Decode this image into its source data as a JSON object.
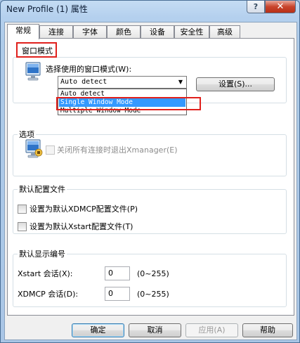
{
  "window": {
    "title": "New Profile (1) 属性",
    "help_glyph": "?",
    "close_glyph": "✕"
  },
  "tabs": [
    "常规",
    "连接",
    "字体",
    "颜色",
    "设备",
    "安全性",
    "高级"
  ],
  "window_mode": {
    "legend": "窗口模式",
    "prompt": "选择使用的窗口模式(W):",
    "selected": "Auto detect",
    "options": [
      "Auto detect",
      "Single Window Mode",
      "Multiple Window Mode"
    ],
    "highlighted_option": "Single Window Mode",
    "settings_button": "设置(S)..."
  },
  "options": {
    "legend": "选项",
    "close_on_exit_label": "关闭所有连接时退出Xmanager(E)"
  },
  "default_profile": {
    "legend": "默认配置文件",
    "xdmcp_label": "设置为默认XDMCP配置文件(P)",
    "xstart_label": "设置为默认Xstart配置文件(T)"
  },
  "default_display": {
    "legend": "默认显示编号",
    "xstart_label": "Xstart 会话(X):",
    "xstart_value": "0",
    "xstart_range": "(0~255)",
    "xdmcp_label": "XDMCP 会话(D):",
    "xdmcp_value": "0",
    "xdmcp_range": "(0~255)"
  },
  "buttons": {
    "ok": "确定",
    "cancel": "取消",
    "apply": "应用(A)",
    "help": "帮助"
  },
  "colors": {
    "highlight_red": "#e0201c",
    "selection_blue": "#3399ff"
  }
}
